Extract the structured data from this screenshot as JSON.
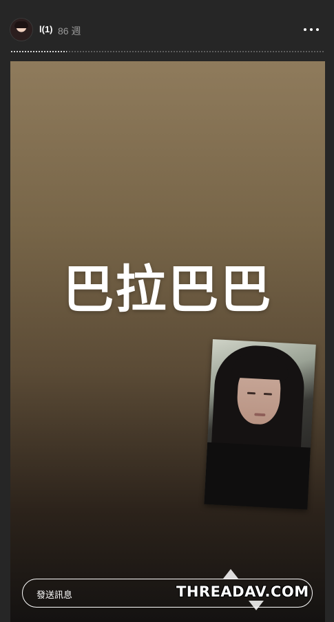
{
  "header": {
    "username": "l(1)",
    "time_ago": "86 週",
    "more_icon": "more-horizontal-icon"
  },
  "progress": {
    "segments": 1,
    "fraction": 0.18
  },
  "story": {
    "text": "巴拉巴巴",
    "background_top": "#8f7b5c",
    "background_bottom": "#141211"
  },
  "message_bar": {
    "placeholder": "發送訊息"
  },
  "watermark": {
    "text": "THREADAV.COM"
  }
}
